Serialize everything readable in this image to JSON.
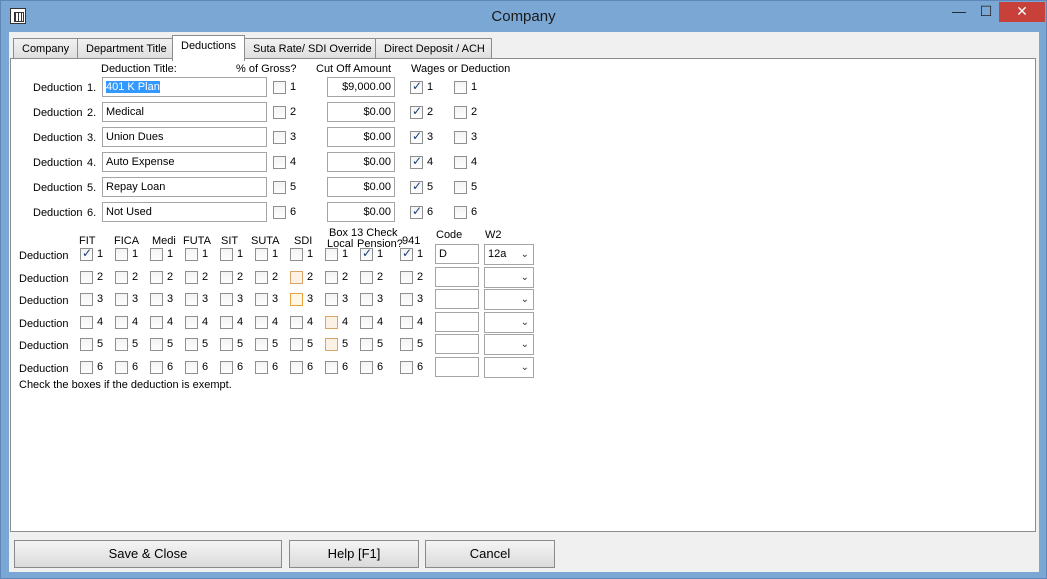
{
  "window": {
    "title": "Company",
    "minimize": "—",
    "maximize": "☐",
    "close": "✕"
  },
  "tabs": [
    "Company",
    "Department Title",
    "Deductions",
    "Suta Rate/ SDI Override",
    "Direct Deposit / ACH"
  ],
  "headers": {
    "deduction_title": "Deduction Title:",
    "pct_gross": "% of Gross?",
    "cutoff": "Cut Off Amount",
    "wages_or_deduction": "Wages or Deduction"
  },
  "deductions": [
    {
      "label": "Deduction",
      "num": "1.",
      "title": "401 K Plan",
      "pct": false,
      "pct_n": "1",
      "cutoff": "$9,000.00",
      "w": true,
      "w_n": "1",
      "d": false,
      "d_n": "1"
    },
    {
      "label": "Deduction",
      "num": "2.",
      "title": "Medical",
      "pct": false,
      "pct_n": "2",
      "cutoff": "$0.00",
      "w": true,
      "w_n": "2",
      "d": false,
      "d_n": "2"
    },
    {
      "label": "Deduction",
      "num": "3.",
      "title": "Union Dues",
      "pct": false,
      "pct_n": "3",
      "cutoff": "$0.00",
      "w": true,
      "w_n": "3",
      "d": false,
      "d_n": "3"
    },
    {
      "label": "Deduction",
      "num": "4.",
      "title": "Auto Expense",
      "pct": false,
      "pct_n": "4",
      "cutoff": "$0.00",
      "w": true,
      "w_n": "4",
      "d": false,
      "d_n": "4"
    },
    {
      "label": "Deduction",
      "num": "5.",
      "title": "Repay Loan",
      "pct": false,
      "pct_n": "5",
      "cutoff": "$0.00",
      "w": true,
      "w_n": "5",
      "d": false,
      "d_n": "5"
    },
    {
      "label": "Deduction",
      "num": "6.",
      "title": "Not Used",
      "pct": false,
      "pct_n": "6",
      "cutoff": "$0.00",
      "w": true,
      "w_n": "6",
      "d": false,
      "d_n": "6"
    }
  ],
  "exempt": {
    "columns": [
      "FIT",
      "FICA",
      "Medi",
      "FUTA",
      "SIT",
      "SUTA",
      "SDI",
      "Local",
      "Pension?",
      "941"
    ],
    "box13": "Box 13 Check",
    "code_header": "Code",
    "w2_header": "W2",
    "row_label": "Deduction",
    "rows": [
      {
        "checks": [
          true,
          false,
          false,
          false,
          false,
          false,
          false,
          false,
          true,
          true
        ],
        "n": "1",
        "code": "D",
        "w2": "12a"
      },
      {
        "checks": [
          false,
          false,
          false,
          false,
          false,
          false,
          false,
          false,
          false,
          false
        ],
        "n": "2",
        "code": "",
        "w2": ""
      },
      {
        "checks": [
          false,
          false,
          false,
          false,
          false,
          false,
          false,
          false,
          false,
          false
        ],
        "n": "3",
        "code": "",
        "w2": ""
      },
      {
        "checks": [
          false,
          false,
          false,
          false,
          false,
          false,
          false,
          false,
          false,
          false
        ],
        "n": "4",
        "code": "",
        "w2": ""
      },
      {
        "checks": [
          false,
          false,
          false,
          false,
          false,
          false,
          false,
          false,
          false,
          false
        ],
        "n": "5",
        "code": "",
        "w2": ""
      },
      {
        "checks": [
          false,
          false,
          false,
          false,
          false,
          false,
          false,
          false,
          false,
          false
        ],
        "n": "6",
        "code": "",
        "w2": ""
      }
    ],
    "note": "Check the boxes if the deduction is exempt."
  },
  "buttons": {
    "save_close": "Save & Close",
    "help": "Help [F1]",
    "cancel": "Cancel"
  }
}
